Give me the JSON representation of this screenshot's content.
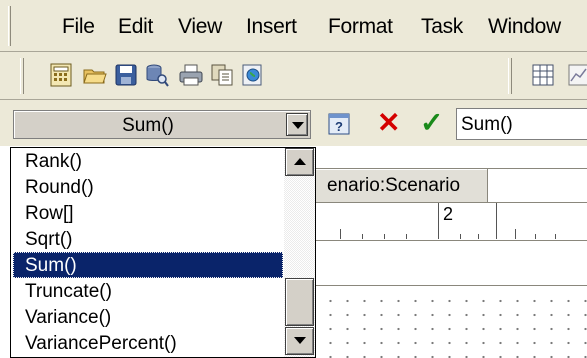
{
  "menu": [
    "File",
    "Edit",
    "View",
    "Insert",
    "Format",
    "Task",
    "Window"
  ],
  "toolbar": {
    "buttons": [
      "calculator-icon",
      "open-folder-icon",
      "save-icon",
      "database-search-icon",
      "print-icon",
      "copy-pages-icon",
      "globe-document-icon",
      "grid-icon",
      "chart-icon"
    ]
  },
  "formula_bar": {
    "function_selector_value": "Sum()",
    "formula_value": "Sum()",
    "cancel_symbol": "✕",
    "accept_symbol": "✓",
    "colors": {
      "cancel": "#d40000",
      "accept": "#1a8a1a"
    }
  },
  "function_list": {
    "items": [
      "Rank()",
      "Round()",
      "Row[]",
      "Sqrt()",
      "Sum()",
      "Truncate()",
      "Variance()",
      "VariancePercent()"
    ],
    "selected": "Sum()",
    "selected_color": "#0a246a"
  },
  "sheet": {
    "tab_label": "enario:Scenario",
    "ruler_label": "2"
  }
}
